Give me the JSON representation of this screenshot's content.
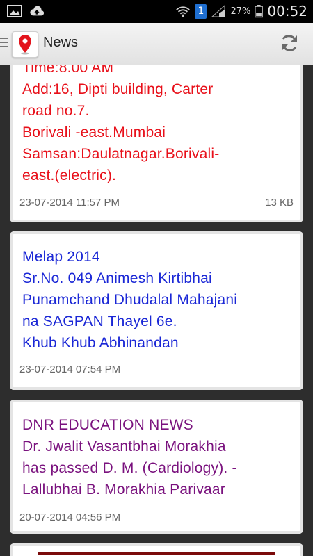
{
  "status_bar": {
    "battery_pct": "27%",
    "time": "00:52",
    "notification_count": "1"
  },
  "action_bar": {
    "title": "News",
    "icons": [
      "menu-icon",
      "location-pin-icon",
      "refresh-icon"
    ]
  },
  "colors": {
    "red_text": "#e8101a",
    "blue_text": "#1a27d6",
    "purple_text": "#7a127e"
  },
  "news": [
    {
      "lines": [
        "Time:8.00 AM",
        "Add:16, Dipti building, Carter",
        "road no.7.",
        "Borivali -east.Mumbai",
        "Samsan:Daulatnagar.Borivali-",
        "east.(electric)."
      ],
      "date": "23-07-2014 11:57 PM",
      "size": "13 KB"
    },
    {
      "lines": [
        "Melap 2014",
        "Sr.No. 049 Animesh Kirtibhai",
        "Punamchand Dhudalal Mahajani",
        "na SAGPAN Thayel 6e.",
        "Khub Khub Abhinandan"
      ],
      "date": "23-07-2014 07:54 PM"
    },
    {
      "lines": [
        "DNR EDUCATION NEWS",
        "Dr. Jwalit Vasantbhai Morakhia",
        "has passed D. M. (Cardiology). -",
        "Lallubhai B. Morakhia Parivaar"
      ],
      "date": "20-07-2014 04:56 PM"
    }
  ]
}
